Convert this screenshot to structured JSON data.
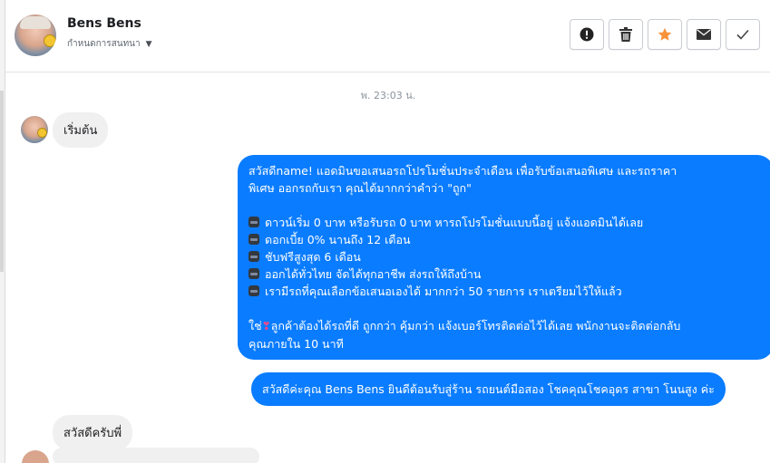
{
  "header": {
    "contact_name": "Bens Bens",
    "status_label": "กำหนดการสนทนา",
    "actions": [
      {
        "name": "report-button",
        "icon": "alert-icon"
      },
      {
        "name": "delete-button",
        "icon": "trash-icon"
      },
      {
        "name": "star-button",
        "icon": "star-icon",
        "color": "#f7923a"
      },
      {
        "name": "mark-unread-button",
        "icon": "envelope-icon"
      },
      {
        "name": "mark-done-button",
        "icon": "check-icon"
      }
    ]
  },
  "conversation": {
    "timestamp": "พ. 23:03 น.",
    "messages": [
      {
        "from": "user",
        "text": "เริ่มต้น"
      },
      {
        "from": "page",
        "lines": [
          "สวัสดีname! แอดมินขอเสนอรถโปรโมชั่นประจำเดือน เพื่อรับข้อเสนอพิเศษ และรถราคา",
          "พิเศษ ออกรถกับเรา คุณได้มากกว่าคำว่า \"ถูก\""
        ],
        "bullets": [
          "ดาวน์เริ่ม 0 บาท หรือรับรถ 0 บาท หารถโปรโมชั่นแบบนี้อยู่ แจ้งแอดมินได้เลย",
          "ดอกเบี้ย 0% นานถึง 12 เดือน",
          "ชับฟรีสูงสุด 6 เดือน",
          "ออกได้ทั่วไทย จัดได้ทุกอาชีพ ส่งรถให้ถึงบ้าน",
          "เรามีรถที่คุณเลือกข้อเสนอเองได้ มากกว่า 50 รายการ เราเตรียมไว้ให้แล้ว"
        ],
        "closing_prefix": "ใช่",
        "closing_line1": "ลูกค้าต้องได้รถที่ดี ถูกกว่า คุ้มกว่า แจ้งเบอร์โทรติดต่อไว้ได้เลย พนักงานจะติดต่อกลับ",
        "closing_line2": "คุณภายใน 10 นาที"
      },
      {
        "from": "page",
        "text": "สวัสดีค่ะคุณ Bens Bens ยินดีต้อนรับสู่ร้าน รถยนต์มือสอง โชคคุณโชคอุดร สาขา โนนสูง ค่ะ"
      },
      {
        "from": "user",
        "text": "สวัสดีครับพี่"
      }
    ]
  },
  "colors": {
    "outgoing_bubble": "#0a7cff",
    "incoming_bubble": "#f1f0f0",
    "star_accent": "#f7923a"
  }
}
